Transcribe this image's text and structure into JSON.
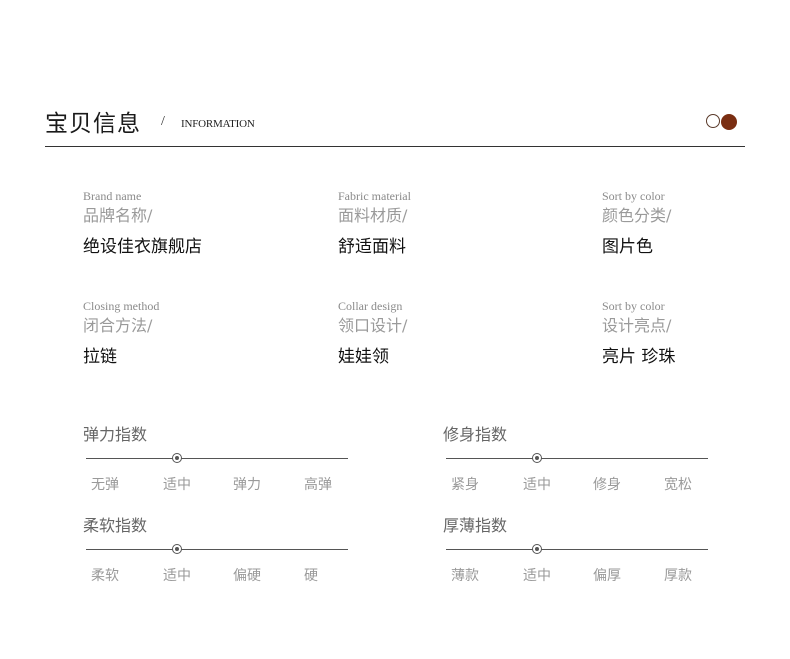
{
  "header": {
    "title": "宝贝信息",
    "slash": "/",
    "subtitle": "INFORMATION",
    "dot_outline_color": "#5a3a2a",
    "dot_fill_color": "#7a2e12"
  },
  "info": [
    {
      "en": "Brand name",
      "cn": "品牌名称/",
      "value": "绝设佳衣旗舰店"
    },
    {
      "en": "Fabric material",
      "cn": "面料材质/",
      "value": "舒适面料"
    },
    {
      "en": "Sort by color",
      "cn": "颜色分类/",
      "value": "图片色"
    },
    {
      "en": "Closing method",
      "cn": "闭合方法/",
      "value": "拉链"
    },
    {
      "en": "Collar design",
      "cn": "领口设计/",
      "value": "娃娃领"
    },
    {
      "en": "Sort by color",
      "cn": "设计亮点/",
      "value": "亮片 珍珠"
    }
  ],
  "sliders": [
    {
      "title": "弹力指数",
      "labels": [
        "无弹",
        "适中",
        "弹力",
        "高弹"
      ],
      "selected_index": 1
    },
    {
      "title": "修身指数",
      "labels": [
        "紧身",
        "适中",
        "修身",
        "宽松"
      ],
      "selected_index": 1
    },
    {
      "title": "柔软指数",
      "labels": [
        "柔软",
        "适中",
        "偏硬",
        "硬"
      ],
      "selected_index": 1
    },
    {
      "title": "厚薄指数",
      "labels": [
        "薄款",
        "适中",
        "偏厚",
        "厚款"
      ],
      "selected_index": 1
    }
  ]
}
